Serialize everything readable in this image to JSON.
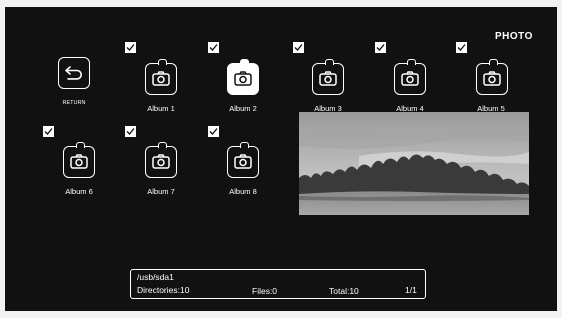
{
  "header": {
    "title": "PHOTO"
  },
  "return_item": {
    "label": "RETURN"
  },
  "albums": [
    {
      "label": "Album 1",
      "checked": true,
      "selected": false
    },
    {
      "label": "Album 2",
      "checked": true,
      "selected": true
    },
    {
      "label": "Album 3",
      "checked": true,
      "selected": false
    },
    {
      "label": "Album 4",
      "checked": true,
      "selected": false
    },
    {
      "label": "Album 5",
      "checked": true,
      "selected": false
    },
    {
      "label": "Album 6",
      "checked": true,
      "selected": false
    },
    {
      "label": "Album 7",
      "checked": true,
      "selected": false
    },
    {
      "label": "Album 8",
      "checked": true,
      "selected": false
    }
  ],
  "status": {
    "path": "/usb/sda1",
    "directories": "Directories:10",
    "files": "Files:0",
    "total": "Total:10",
    "page": "1/1"
  },
  "icons": {
    "return": "return-arrow-icon",
    "album": "camera-icon",
    "check": "checkmark-icon"
  },
  "colors": {
    "background": "#111111",
    "foreground": "#ffffff"
  }
}
